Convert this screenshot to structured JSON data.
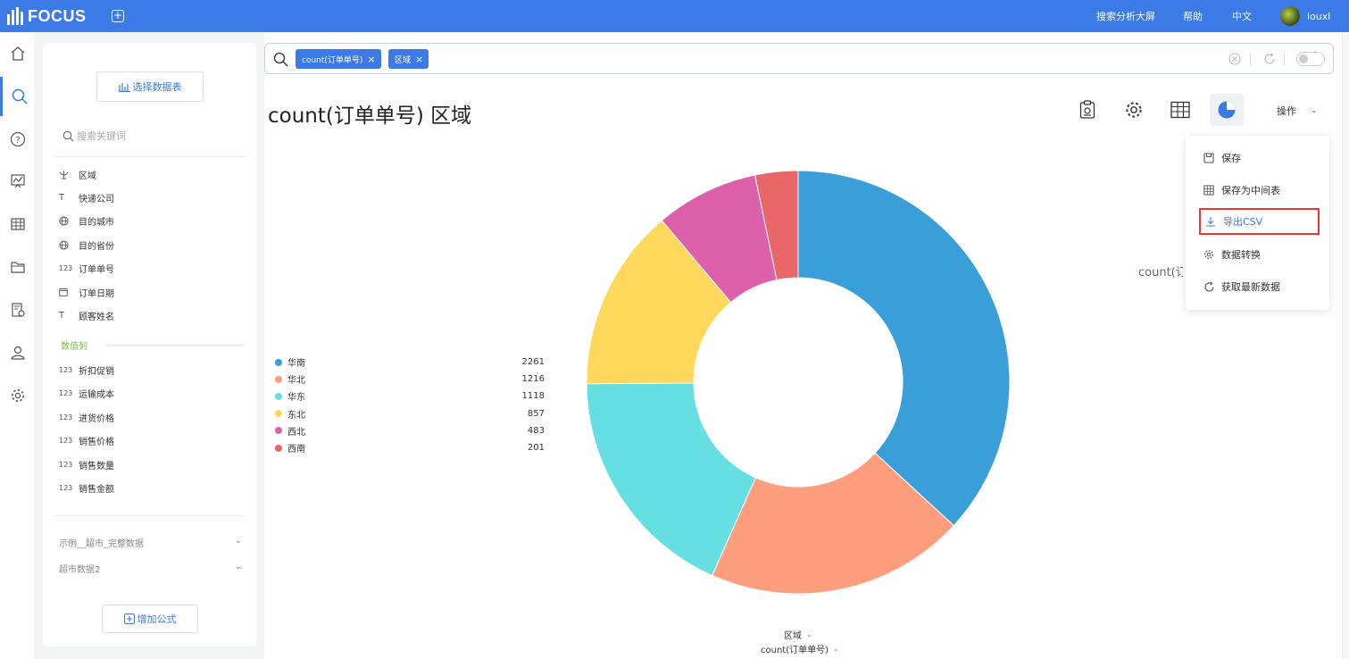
{
  "app": {
    "logo_text": "FOCUS",
    "add_tab_icon": "plus-square-icon"
  },
  "topbar": {
    "dashboard": "搜索分析大屏",
    "help": "帮助",
    "language": "中文",
    "username": "louxl"
  },
  "rail": [
    "home-icon",
    "search-icon",
    "help-icon",
    "dashboard-icon",
    "table-icon",
    "folder-icon",
    "settings-doc-icon",
    "user-icon",
    "gear-icon"
  ],
  "panel": {
    "select_table": "选择数据表",
    "search_placeholder": "搜索关键词",
    "attribute_columns": [
      {
        "icon": "geo",
        "name": "区域"
      },
      {
        "icon": "text",
        "name": "快递公司"
      },
      {
        "icon": "globe",
        "name": "目的城市"
      },
      {
        "icon": "globe",
        "name": "目的省份"
      },
      {
        "icon": "123",
        "name": "订单单号"
      },
      {
        "icon": "date",
        "name": "订单日期"
      },
      {
        "icon": "text",
        "name": "顾客姓名"
      }
    ],
    "measure_group": "数值列",
    "measure_columns": [
      {
        "icon": "123",
        "name": "折扣促销"
      },
      {
        "icon": "123",
        "name": "运输成本"
      },
      {
        "icon": "123",
        "name": "进货价格"
      },
      {
        "icon": "123",
        "name": "销售价格"
      },
      {
        "icon": "123",
        "name": "销售数量"
      },
      {
        "icon": "123",
        "name": "销售金额"
      }
    ],
    "sources": [
      "示例__超市_完整数据",
      "超市数据2"
    ],
    "add_formula": "增加公式"
  },
  "search": {
    "tags": [
      "count(订单单号)",
      "区域"
    ]
  },
  "title": "count(订单单号) 区域",
  "toolbar": {
    "operations": "操作"
  },
  "dropdown": [
    "保存",
    "保存为中间表",
    "导出CSV",
    "数据转换",
    "获取最新数据"
  ],
  "clipped_label": "count(订单单号)",
  "colors": {
    "accent": "#3b7ae7",
    "highlight_border": "#e53935"
  },
  "chart_data": {
    "type": "pie",
    "variant": "donut",
    "categories": [
      "华南",
      "华北",
      "华东",
      "东北",
      "西北",
      "西南"
    ],
    "values": [
      2261,
      1216,
      1118,
      857,
      483,
      201
    ],
    "colors": [
      "#3a9fd9",
      "#ff9e7d",
      "#66dfe2",
      "#ffd85c",
      "#dd60ab",
      "#e96768"
    ],
    "legend_position": "left"
  },
  "axes": {
    "category": "区域",
    "value": "count(订单单号)"
  }
}
